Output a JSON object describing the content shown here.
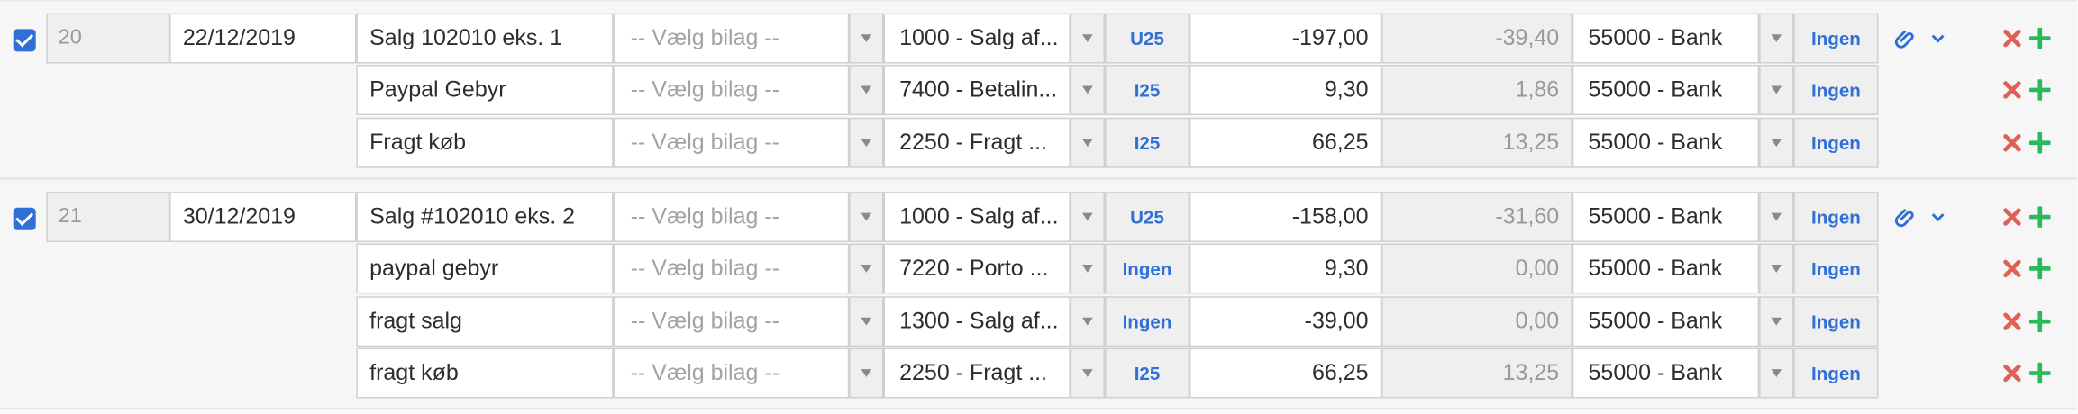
{
  "groups": [
    {
      "checked": true,
      "id": "20",
      "date": "22/12/2019",
      "lines": [
        {
          "desc": "Salg 102010 eks. 1",
          "bilag": "-- Vælg bilag --",
          "account": "1000 - Salg af...",
          "vat": "U25",
          "amount": "-197,00",
          "vat_amount": "-39,40",
          "bank": "55000 - Bank",
          "vat2": "Ingen"
        },
        {
          "desc": "Paypal Gebyr",
          "bilag": "-- Vælg bilag --",
          "account": "7400 - Betalin...",
          "vat": "I25",
          "amount": "9,30",
          "vat_amount": "1,86",
          "bank": "55000 - Bank",
          "vat2": "Ingen"
        },
        {
          "desc": "Fragt køb",
          "bilag": "-- Vælg bilag --",
          "account": "2250 - Fragt ...",
          "vat": "I25",
          "amount": "66,25",
          "vat_amount": "13,25",
          "bank": "55000 - Bank",
          "vat2": "Ingen"
        }
      ]
    },
    {
      "checked": true,
      "id": "21",
      "date": "30/12/2019",
      "lines": [
        {
          "desc": "Salg #102010 eks. 2",
          "bilag": "-- Vælg bilag --",
          "account": "1000 - Salg af...",
          "vat": "U25",
          "amount": "-158,00",
          "vat_amount": "-31,60",
          "bank": "55000 - Bank",
          "vat2": "Ingen"
        },
        {
          "desc": "paypal gebyr",
          "bilag": "-- Vælg bilag --",
          "account": "7220 - Porto ...",
          "vat": "Ingen",
          "amount": "9,30",
          "vat_amount": "0,00",
          "bank": "55000 - Bank",
          "vat2": "Ingen"
        },
        {
          "desc": "fragt salg",
          "bilag": "-- Vælg bilag --",
          "account": "1300 - Salg af...",
          "vat": "Ingen",
          "amount": "-39,00",
          "vat_amount": "0,00",
          "bank": "55000 - Bank",
          "vat2": "Ingen"
        },
        {
          "desc": "fragt køb",
          "bilag": "-- Vælg bilag --",
          "account": "2250 - Fragt ...",
          "vat": "I25",
          "amount": "66,25",
          "vat_amount": "13,25",
          "bank": "55000 - Bank",
          "vat2": "Ingen"
        }
      ]
    }
  ],
  "icons": {
    "attach": "paperclip-icon",
    "expand": "chevron-down-icon",
    "delete": "delete-x-icon",
    "add": "add-plus-icon"
  },
  "colors": {
    "accent": "#2f6fd6",
    "delete": "#e06055",
    "add": "#2eb85c"
  }
}
